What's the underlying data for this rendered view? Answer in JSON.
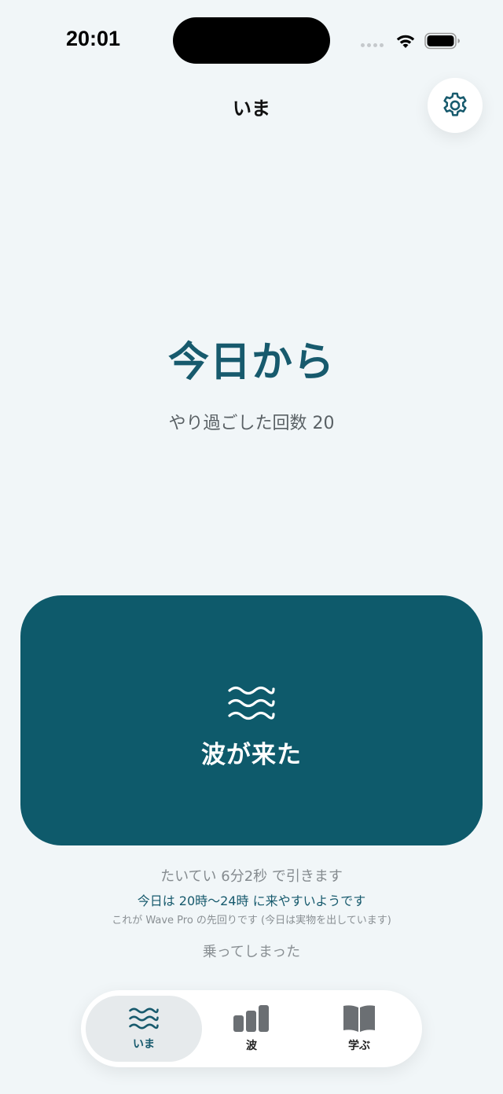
{
  "status_bar": {
    "time": "20:01"
  },
  "nav": {
    "title": "いま"
  },
  "hero": {
    "headline": "今日から",
    "count_label": "やり過ごした回数",
    "count_value": "20"
  },
  "wave_button": {
    "label": "波が来た",
    "icon": "wave-icon"
  },
  "hints": {
    "duration": "たいてい 6分2秒 で引きます",
    "time_window": "今日は 20時〜24時 に来やすいようです",
    "pro_note": "これが Wave Pro の先回りです (今日は実物を出しています)"
  },
  "rode_link": "乗ってしまった",
  "tabs": [
    {
      "label": "いま",
      "icon": "wave-icon",
      "active": true
    },
    {
      "label": "波",
      "icon": "bar-chart-icon",
      "active": false
    },
    {
      "label": "学ぶ",
      "icon": "book-icon",
      "active": false
    }
  ],
  "colors": {
    "accent": "#0e5a6b",
    "headline": "#175a6d",
    "background": "#f1f6f8"
  }
}
